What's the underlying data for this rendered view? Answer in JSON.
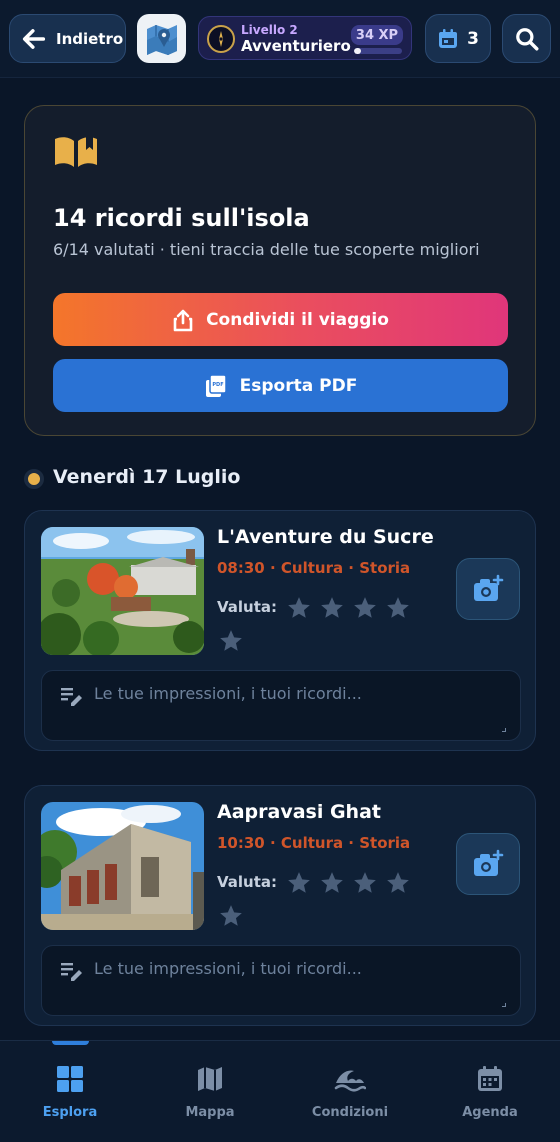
{
  "header": {
    "back_label": "Indietro",
    "level_small": "Livello 2",
    "level_title": "Avventuriero",
    "xp": "34 XP",
    "xp_progress": 0.15,
    "calendar_count": "3"
  },
  "summary": {
    "title": "14 ricordi sull'isola",
    "subtitle": "6/14 valutati · tieni traccia delle tue scoperte migliori",
    "share_label": "Condividi il viaggio",
    "pdf_label": "Esporta PDF"
  },
  "day": {
    "title": "Venerdì 17 Luglio"
  },
  "memories": [
    {
      "name": "L'Aventure du Sucre",
      "meta": "08:30 · Cultura · Storia",
      "rate_label": "Valuta:",
      "rating": 0,
      "notes_placeholder": "Le tue impressioni, i tuoi ricordi..."
    },
    {
      "name": "Aapravasi Ghat",
      "meta": "10:30 · Cultura · Storia",
      "rate_label": "Valuta:",
      "rating": 0,
      "notes_placeholder": "Le tue impressioni, i tuoi ricordi..."
    }
  ],
  "nav": {
    "items": [
      {
        "label": "Esplora",
        "icon": "grid-icon",
        "active": true
      },
      {
        "label": "Mappa",
        "icon": "map-icon",
        "active": false
      },
      {
        "label": "Condizioni",
        "icon": "wave-icon",
        "active": false
      },
      {
        "label": "Agenda",
        "icon": "calendar-icon",
        "active": false
      }
    ]
  },
  "colors": {
    "accent": "#2f7fdc",
    "meta": "#d0552a",
    "gold": "#e8b04a"
  }
}
